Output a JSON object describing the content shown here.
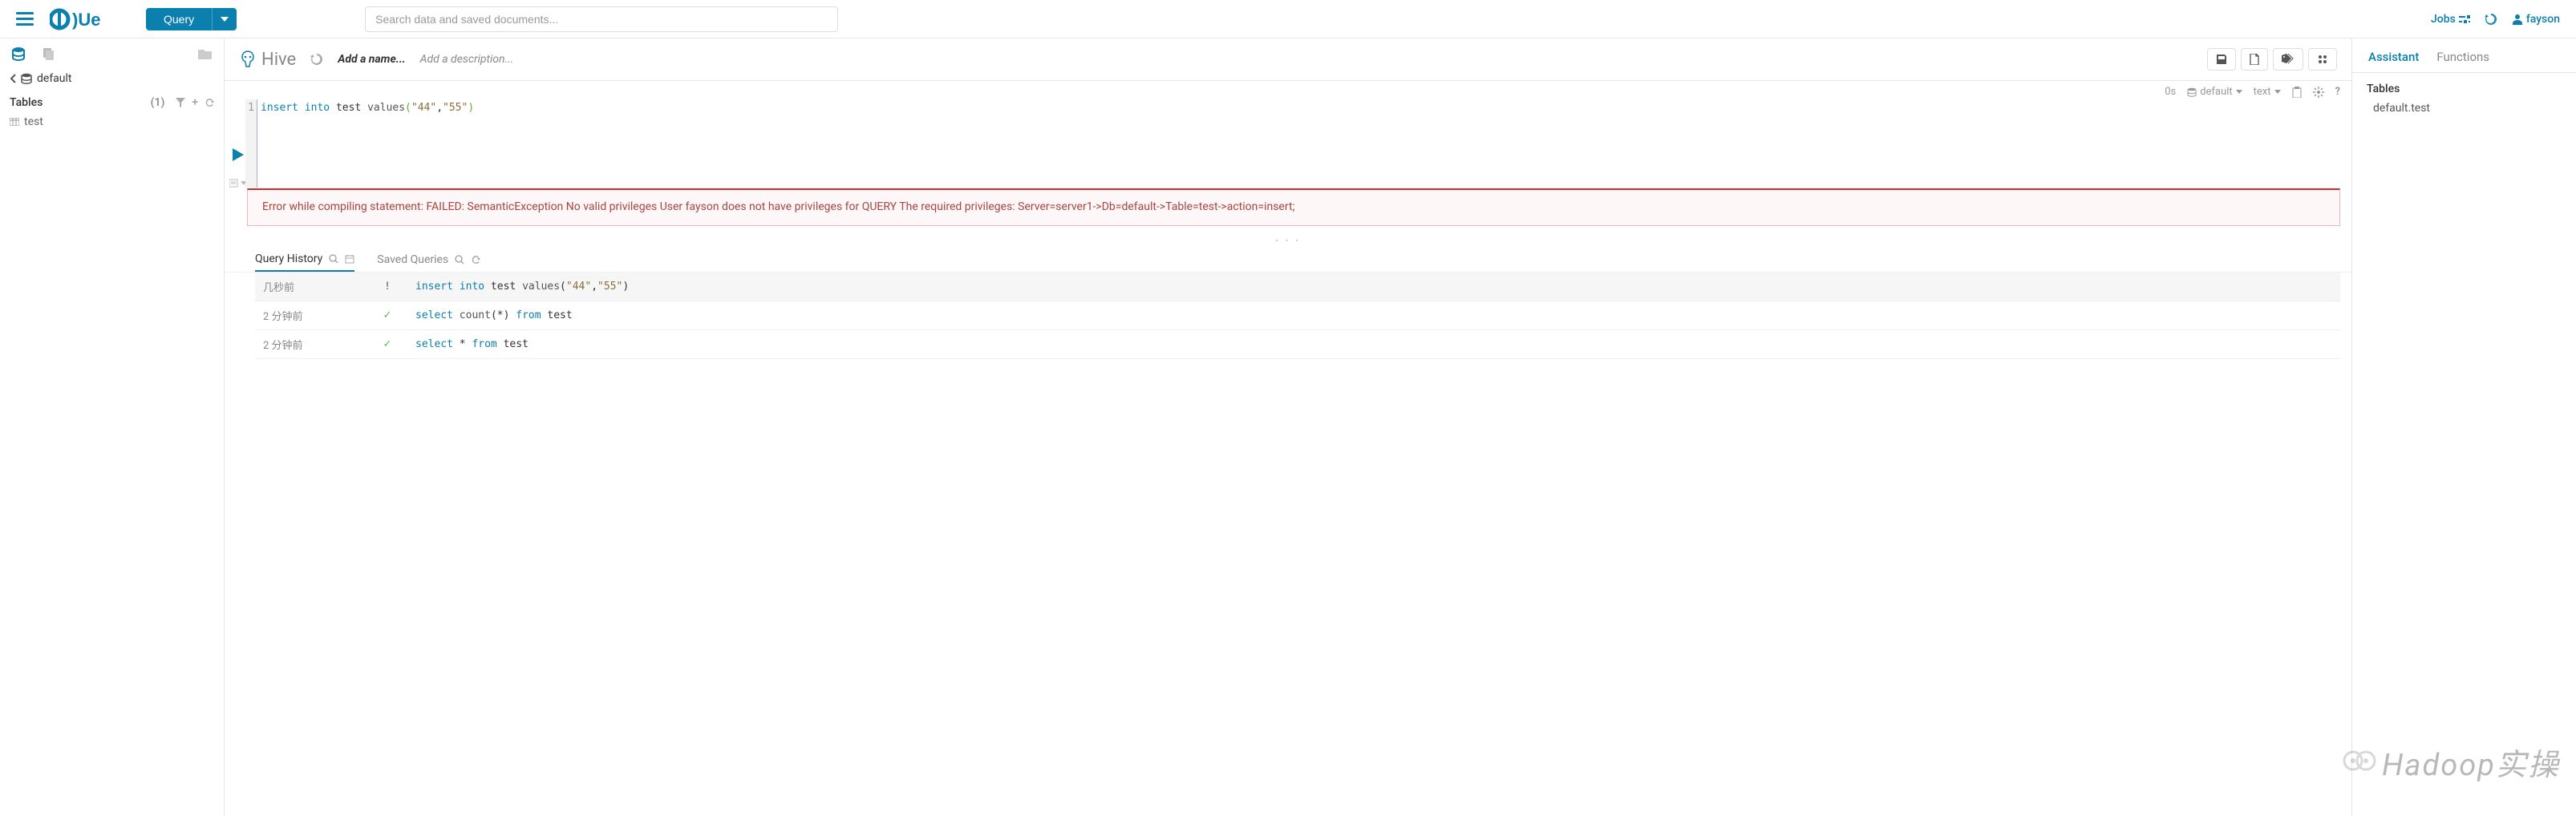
{
  "topbar": {
    "query_btn": "Query",
    "search_placeholder": "Search data and saved documents...",
    "jobs": "Jobs",
    "user": "fayson"
  },
  "left": {
    "database": "default",
    "tables_header": "Tables",
    "table_count": "(1)",
    "tables": [
      "test"
    ]
  },
  "editor": {
    "engine": "Hive",
    "name_placeholder": "Add a name...",
    "desc_placeholder": "Add a description...",
    "context": {
      "elapsed": "0s",
      "database": "default",
      "type": "text"
    },
    "code": {
      "line_no": "1",
      "k_insert": "insert",
      "k_into": "into",
      "ident": "test",
      "fn": "values",
      "s1": "\"44\"",
      "comma": ",",
      "s2": "\"55\""
    },
    "error": "Error while compiling statement: FAILED: SemanticException No valid privileges User fayson does not have privileges for QUERY The required privileges: Server=server1->Db=default->Table=test->action=insert;"
  },
  "history": {
    "tab_history": "Query History",
    "tab_saved": "Saved Queries",
    "rows": [
      {
        "time": "几秒前",
        "status": "err",
        "sql_html": "<span class='kw'>insert</span> <span class='kw'>into</span> <span class='ident'>test</span> <span class='fn'>values</span>(<span class='str'>\"44\"</span>,<span class='str'>\"55\"</span>)"
      },
      {
        "time": "2 分钟前",
        "status": "ok",
        "sql_html": "<span class='kw'>select</span> <span class='fn'>count</span>(*) <span class='kw'>from</span> <span class='ident'>test</span>"
      },
      {
        "time": "2 分钟前",
        "status": "ok",
        "sql_html": "<span class='kw'>select</span> * <span class='kw'>from</span> <span class='ident'>test</span>"
      }
    ]
  },
  "right": {
    "tab_assistant": "Assistant",
    "tab_functions": "Functions",
    "tables_header": "Tables",
    "tables": [
      "default.test"
    ]
  },
  "watermark": "Hadoop实操"
}
